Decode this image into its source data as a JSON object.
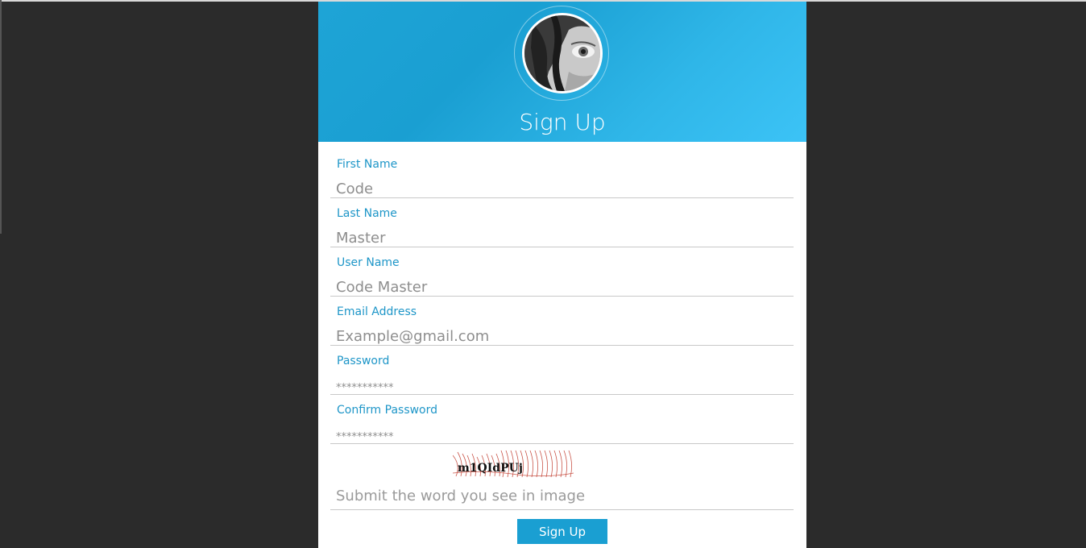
{
  "header": {
    "title": "Sign Up"
  },
  "fields": [
    {
      "label": "First Name",
      "value": "Code"
    },
    {
      "label": "Last Name",
      "value": "Master"
    },
    {
      "label": "User Name",
      "value": "Code Master"
    },
    {
      "label": "Email Address",
      "value": "Example@gmail.com"
    },
    {
      "label": "Password",
      "value": "***********"
    },
    {
      "label": "Confirm Password",
      "value": "***********"
    }
  ],
  "captcha": {
    "image_text": "m1QIdPUj",
    "input_placeholder": "Submit the word you see in image"
  },
  "submit_label": "Sign Up",
  "colors": {
    "accent": "#1a9fd2",
    "label": "#1e96c8",
    "background": "#2b2b2b"
  }
}
